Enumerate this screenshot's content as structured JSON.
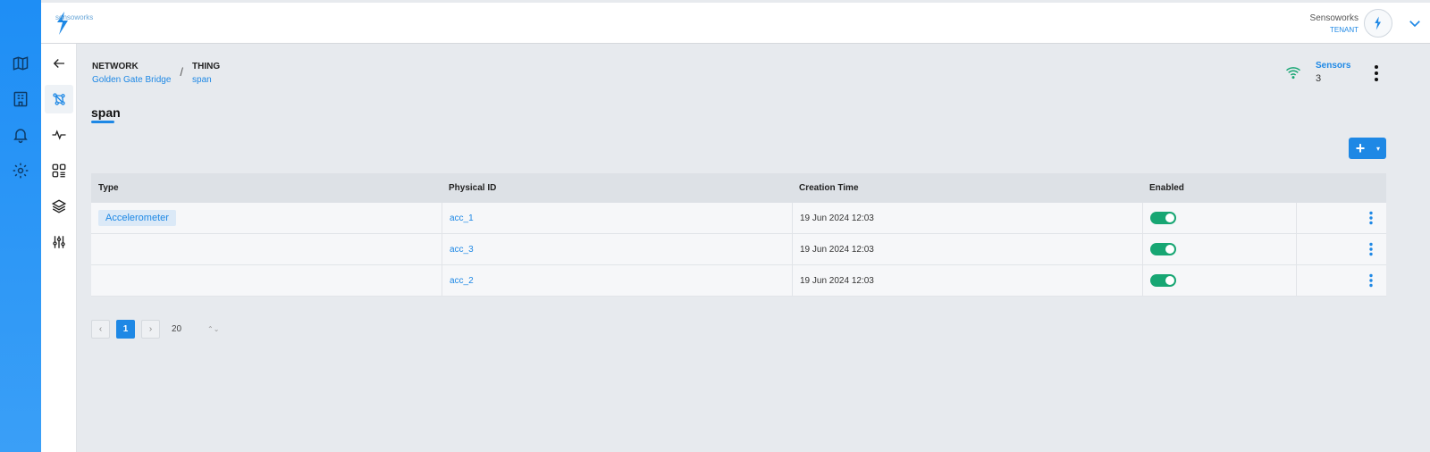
{
  "brand": {
    "logo_text": "sensoworks"
  },
  "header": {
    "user_name": "Sensoworks",
    "user_role": "TENANT"
  },
  "rail": {
    "icons": [
      "map-icon",
      "building-icon",
      "bell-icon",
      "gear-icon"
    ]
  },
  "sidebar": {
    "icons": [
      "back-arrow-icon",
      "network-icon",
      "pulse-icon",
      "dashboard-icon",
      "layers-icon",
      "sliders-icon"
    ],
    "active_index": 1
  },
  "breadcrumb": {
    "network_title": "NETWORK",
    "network_value": "Golden Gate Bridge",
    "separator": "/",
    "thing_title": "THING",
    "thing_value": "span"
  },
  "sensors": {
    "label": "Sensors",
    "count": "3"
  },
  "page": {
    "title": "span"
  },
  "add_button": {
    "label": "+",
    "caret": "▾"
  },
  "table": {
    "columns": [
      "Type",
      "Physical ID",
      "Creation Time",
      "Enabled"
    ],
    "rows": [
      {
        "type": "Accelerometer",
        "physical_id": "acc_1",
        "creation_time": "19 Jun 2024 12:03",
        "enabled": true
      },
      {
        "type": "",
        "physical_id": "acc_3",
        "creation_time": "19 Jun 2024 12:03",
        "enabled": true
      },
      {
        "type": "",
        "physical_id": "acc_2",
        "creation_time": "19 Jun 2024 12:03",
        "enabled": true
      }
    ]
  },
  "pagination": {
    "prev": "‹",
    "current": "1",
    "next": "›",
    "page_size": "20",
    "size_caret": "⌃⌄"
  },
  "colors": {
    "primary": "#1e88e5",
    "toggle_on": "#17a673",
    "rail": "#1e8ef5"
  }
}
